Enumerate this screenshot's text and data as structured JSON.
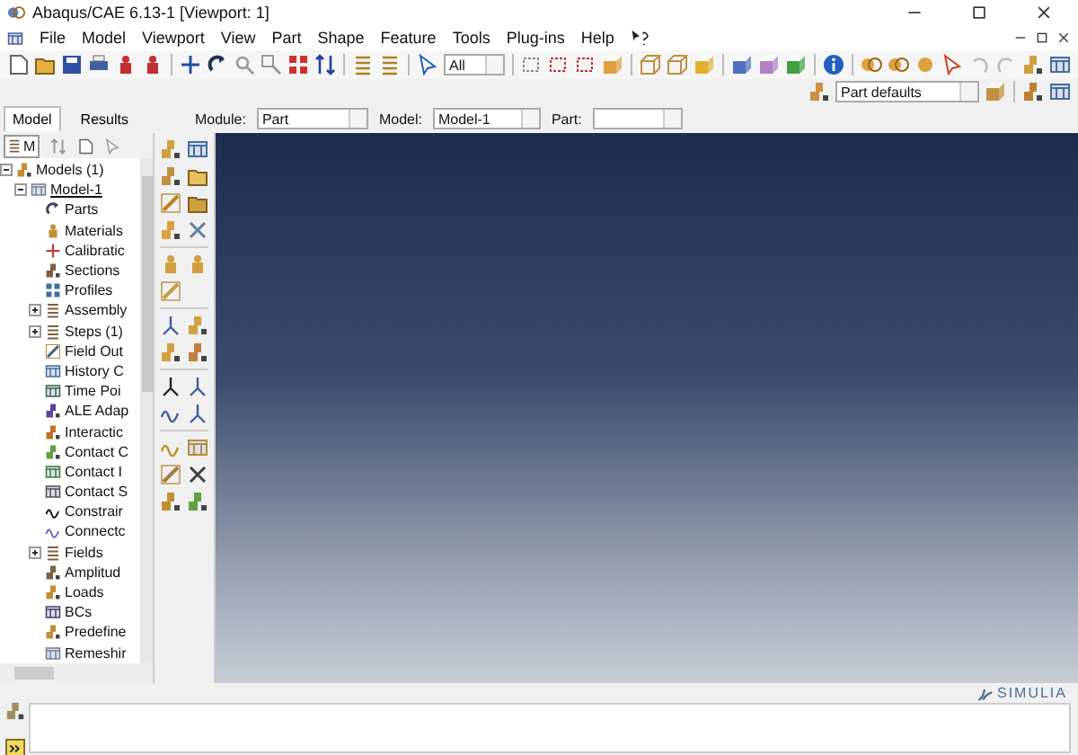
{
  "window": {
    "title": "Abaqus/CAE 6.13-1 [Viewport: 1]"
  },
  "menu": [
    "File",
    "Model",
    "Viewport",
    "View",
    "Part",
    "Shape",
    "Feature",
    "Tools",
    "Plug-ins",
    "Help"
  ],
  "toolbar": {
    "selection_filter": "All",
    "render_style": "Part defaults"
  },
  "panel_tabs": [
    {
      "label": "Model",
      "selected": true
    },
    {
      "label": "Results",
      "selected": false
    }
  ],
  "context_bar": {
    "module_label": "Module:",
    "module": "Part",
    "model_label": "Model:",
    "model": "Model-1",
    "part_label": "Part:"
  },
  "tree_toolbar": {
    "filter": "M"
  },
  "model_tree": [
    {
      "label": "Models (1)",
      "expanded": true,
      "children": [
        {
          "label": "Model-1",
          "expanded": true,
          "current": true,
          "children": [
            {
              "label": "Parts"
            },
            {
              "label": "Materials"
            },
            {
              "label": "Calibratic"
            },
            {
              "label": "Sections"
            },
            {
              "label": "Profiles"
            },
            {
              "label": "Assembly",
              "expanded": false
            },
            {
              "label": "Steps (1)",
              "expanded": false
            },
            {
              "label": "Field Out"
            },
            {
              "label": "History C"
            },
            {
              "label": "Time Poi"
            },
            {
              "label": "ALE Adap"
            },
            {
              "label": "Interactic"
            },
            {
              "label": "Contact C"
            },
            {
              "label": "Contact I"
            },
            {
              "label": "Contact S"
            },
            {
              "label": "Constrair"
            },
            {
              "label": "Connectc"
            },
            {
              "label": "Fields",
              "expanded": false
            },
            {
              "label": "Amplitud"
            },
            {
              "label": "Loads"
            },
            {
              "label": "BCs"
            },
            {
              "label": "Predefine"
            },
            {
              "label": "Remeshir"
            }
          ]
        }
      ]
    }
  ],
  "viewport": {
    "brand": "SIMULIA"
  }
}
